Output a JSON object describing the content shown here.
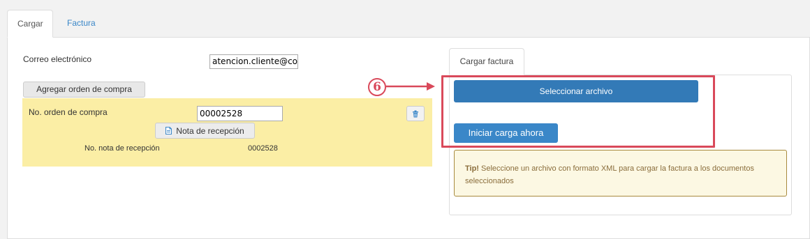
{
  "tabs": [
    {
      "label": "Cargar",
      "active": true
    },
    {
      "label": "Factura",
      "active": false
    }
  ],
  "form": {
    "email_label": "Correo electrónico",
    "email_value": "atencion.cliente@conta",
    "add_po_label": "Agregar orden de compra",
    "po_label": "No. orden de compra",
    "po_value": "00002528",
    "nota_button_label": "Nota de recepción",
    "nota_number_label": "No. nota de recepción",
    "nota_number_value": "0002528"
  },
  "upload_card": {
    "tab_label": "Cargar factura",
    "select_file_label": "Seleccionar archivo",
    "start_upload_label": "Iniciar carga ahora",
    "tip_title": "Tip!",
    "tip_text": "Seleccione un archivo con formato XML para cargar la factura a los documentos seleccionados"
  },
  "annotation": {
    "step_number": "6",
    "color": "#d9495a"
  },
  "colors": {
    "primary": "#337ab7",
    "highlight_yellow": "#fbeea5",
    "tip_background": "#fcf8e3",
    "link": "#3a87c8"
  },
  "icons": {
    "trash": "trash-icon",
    "document": "document-icon"
  }
}
